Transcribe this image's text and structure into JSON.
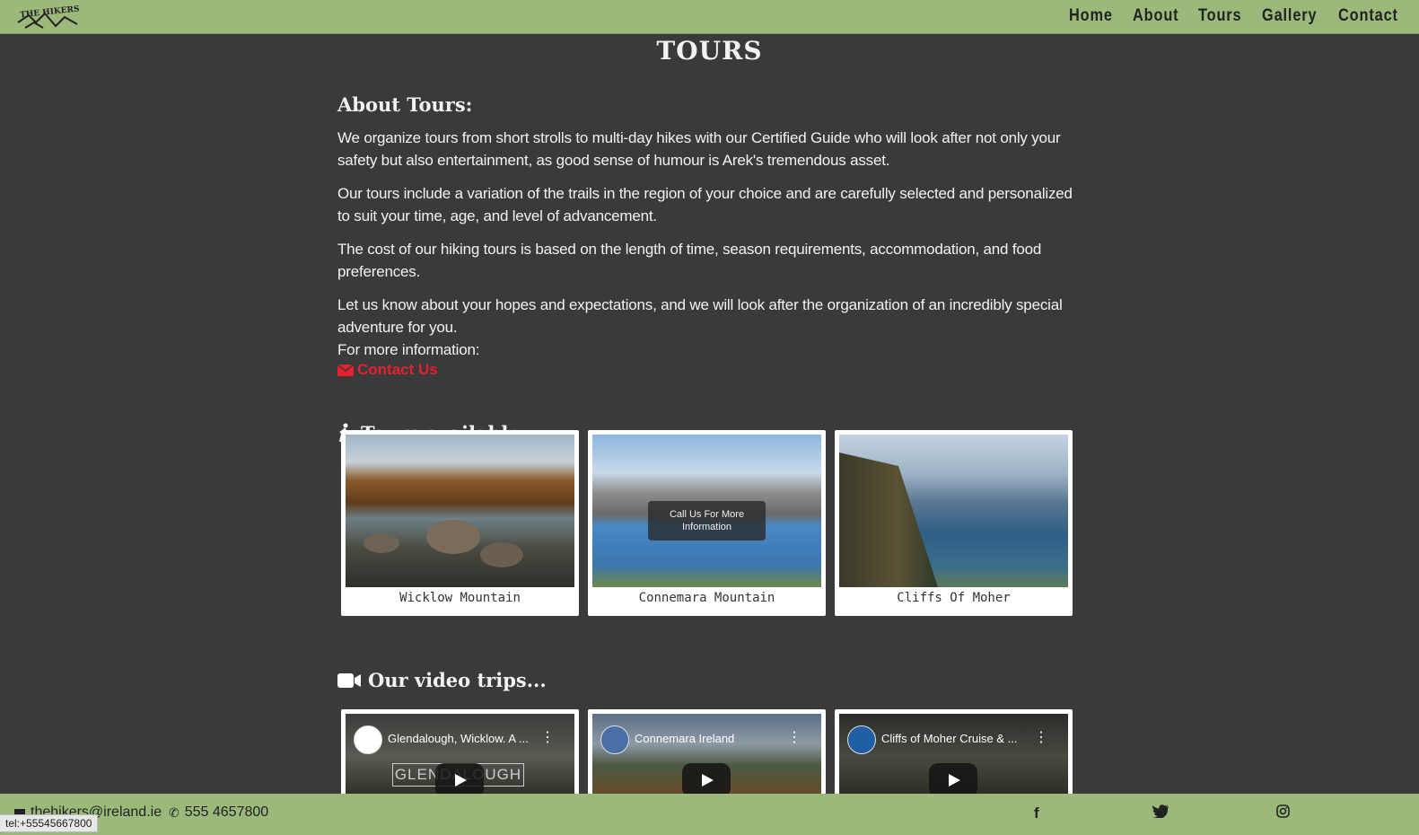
{
  "nav": {
    "logo_alt": "THE HIKERS",
    "links": [
      "Home",
      "About",
      "Tours",
      "Gallery",
      "Contact"
    ]
  },
  "page": {
    "title": "TOURS"
  },
  "about": {
    "heading": "About Tours:",
    "p1": "We organize tours from short strolls to multi-day hikes with our Certified Guide who will look after not only your safety but also entertainment, as good sense of humour is Arek's tremendous asset.",
    "p2": "Our tours include a variation of the trails in the region of your choice and are carefully selected and personalized to suit your time, age, and level of advancement.",
    "p3": "The cost of our hiking tours is based on the length of time, season requirements, accommodation, and food preferences.",
    "p4": "Let us know about your hopes and expectations, and we will look after the organization of an incredibly special adventure for you.",
    "p5": "For more information:",
    "contact_label": "Contact Us"
  },
  "tours": {
    "heading": "Tours available...",
    "cards": [
      {
        "caption": "Wicklow Mountain"
      },
      {
        "caption": "Connemara Mountain",
        "overlay": "Call Us For More Information"
      },
      {
        "caption": "Cliffs Of Moher"
      }
    ]
  },
  "videos": {
    "heading": "Our video trips...",
    "items": [
      {
        "title": "Glendalough, Wicklow. A ..."
      },
      {
        "title": "Connemara Ireland"
      },
      {
        "title": "Cliffs of Moher Cruise & ..."
      }
    ],
    "watermark": "GLENDALOUGH"
  },
  "footer": {
    "email": "thehikers@ireland.ie",
    "phone": "555 4657800",
    "social": [
      "facebook-icon",
      "twitter-icon",
      "instagram-icon"
    ]
  },
  "status_bar": "tel:+55545667800",
  "colors": {
    "nav_bg": "#9cb97c",
    "page_bg": "#3a3a3a",
    "accent": "#e8202d"
  }
}
